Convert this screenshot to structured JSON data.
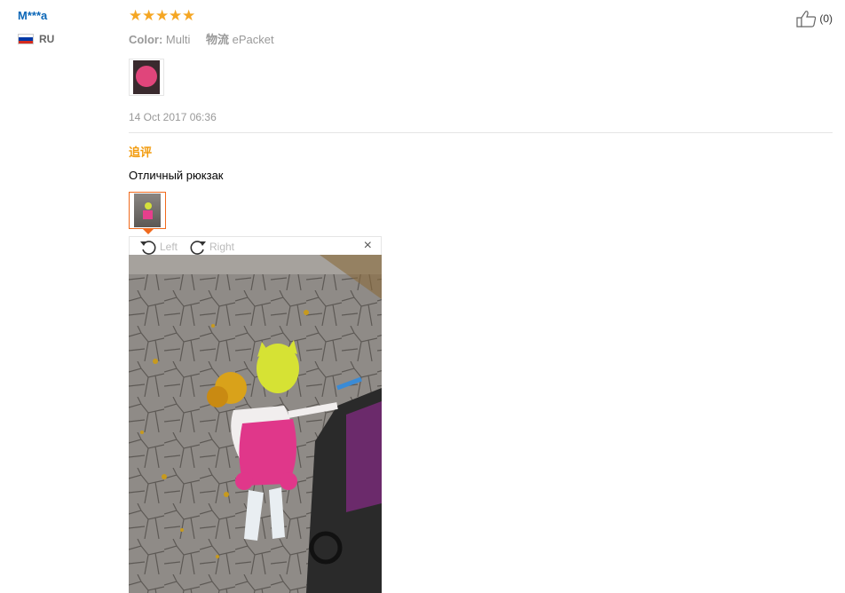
{
  "review": {
    "user": "M***a",
    "country": "RU",
    "rating": 5,
    "color_label": "Color:",
    "color_value": "Multi",
    "shipping_label": "物流",
    "shipping_value": "ePacket",
    "date": "14 Oct 2017 06:36",
    "helpful_count": "(0)"
  },
  "followup": {
    "title": "追评",
    "text": "Отличный рюкзак"
  },
  "viewer": {
    "rotate_left": "Left",
    "rotate_right": "Right",
    "close": "×"
  },
  "icons": {
    "star": "star-icon",
    "thumbs_up": "thumbs-up-icon",
    "rotate_left": "rotate-left-icon",
    "rotate_right": "rotate-right-icon",
    "close": "close-icon"
  },
  "colors": {
    "username": "#0a66b7",
    "star": "#f5a623",
    "followup_title": "#f29b0d",
    "thumb_selected_border": "#f06a1d"
  }
}
